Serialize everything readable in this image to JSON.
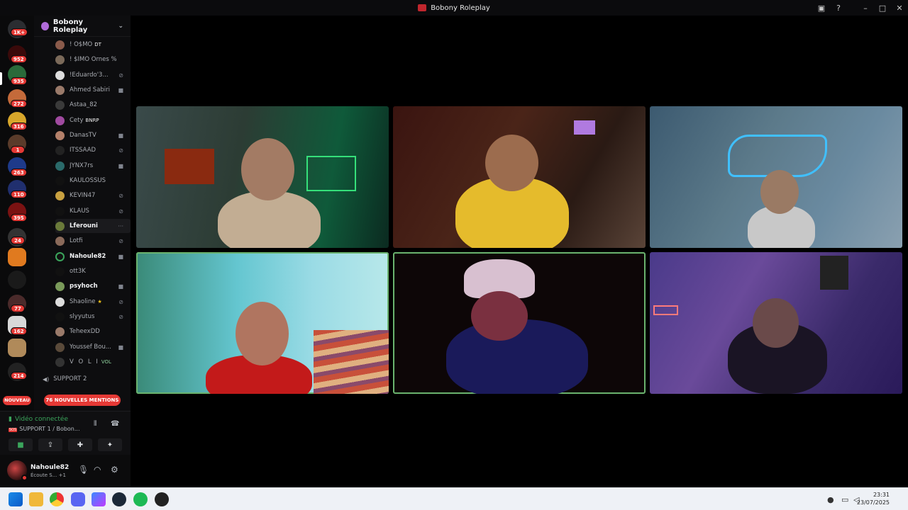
{
  "window": {
    "title": "Bobony Roleplay"
  },
  "servers": {
    "badges": [
      "1K+",
      "952",
      "935",
      "272",
      "316",
      "1",
      "263",
      "110",
      "395",
      "24",
      "77",
      "162",
      "214"
    ],
    "new_label": "NOUVEAU"
  },
  "guild": {
    "name": "Bobony Roleplay"
  },
  "members": [
    {
      "name": "! O$MO",
      "tag": "DT"
    },
    {
      "name": "! $IMO Ornes %",
      "tag": ""
    },
    {
      "name": "!Eduardo'3...",
      "tag": ""
    },
    {
      "name": "Ahmed Sabiri",
      "tag": ""
    },
    {
      "name": "Astaa_82",
      "tag": ""
    },
    {
      "name": "Cety",
      "tag": "BNRP"
    },
    {
      "name": "DanasTV",
      "tag": ""
    },
    {
      "name": "ITSSAAD",
      "tag": ""
    },
    {
      "name": "JYNX7rs",
      "tag": ""
    },
    {
      "name": "KAULOSSUS",
      "tag": ""
    },
    {
      "name": "KEVIN47",
      "tag": ""
    },
    {
      "name": "KLAUS",
      "tag": ""
    },
    {
      "name": "Lferouni",
      "tag": ""
    },
    {
      "name": "Lotfi",
      "tag": ""
    },
    {
      "name": "Nahoule82",
      "tag": ""
    },
    {
      "name": "ott3K",
      "tag": ""
    },
    {
      "name": "psyhoch",
      "tag": ""
    },
    {
      "name": "Shaoline",
      "tag": ""
    },
    {
      "name": "slyyutus",
      "tag": ""
    },
    {
      "name": "TeheexDD",
      "tag": ""
    },
    {
      "name": "Youssef Bou...",
      "tag": ""
    },
    {
      "name": "V O L I",
      "tag": "VOL"
    }
  ],
  "support_channel": {
    "label": "SUPPORT 2"
  },
  "mentions_label": "76 NOUVELLES MENTIONS",
  "voice": {
    "status": "Vidéo connectée",
    "channel": "SUPPORT 1 / Bobon..."
  },
  "user": {
    "name": "Nahoule82",
    "activity": "Écoute S... +1"
  },
  "clock": {
    "time": "23:31",
    "date": "23/07/2025"
  }
}
